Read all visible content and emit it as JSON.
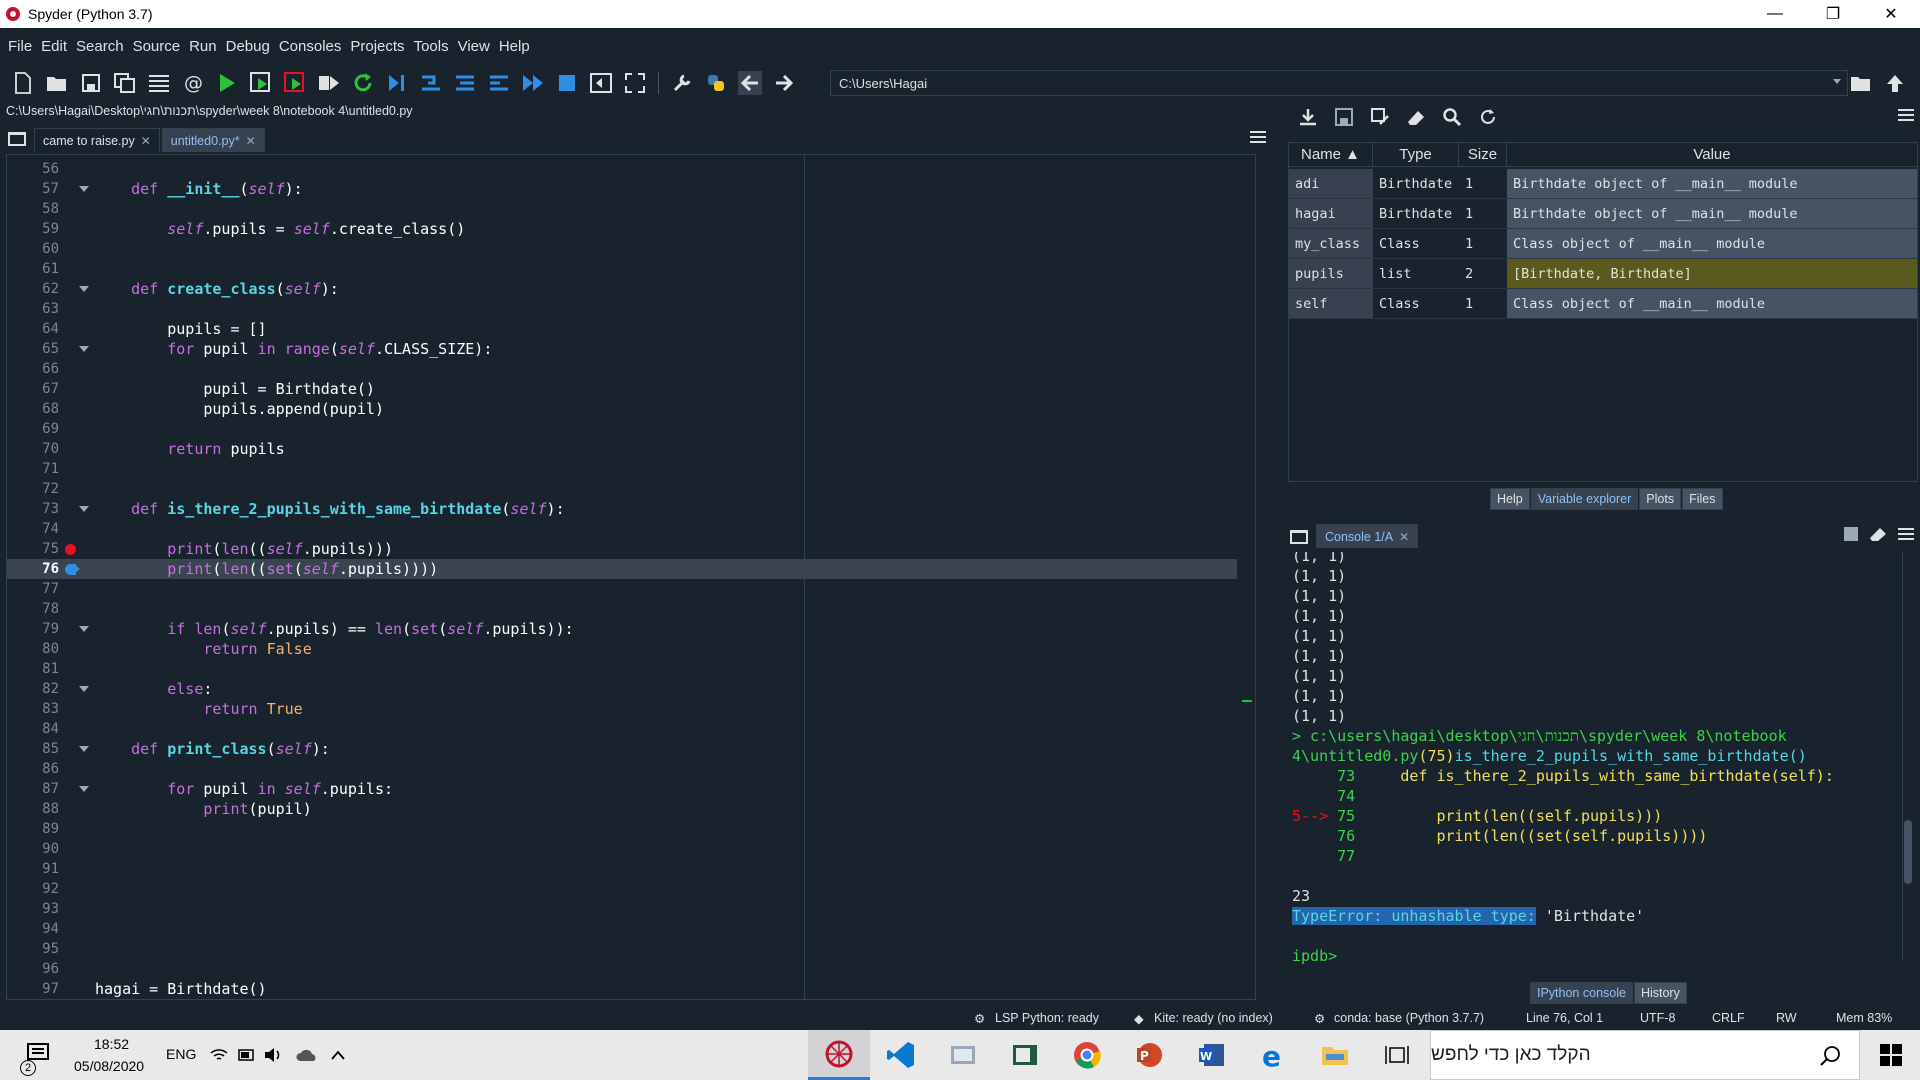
{
  "window": {
    "title": "Spyder (Python 3.7)",
    "minimize": "—",
    "restore": "❐",
    "close": "✕"
  },
  "menu": [
    "File",
    "Edit",
    "Search",
    "Source",
    "Run",
    "Debug",
    "Consoles",
    "Projects",
    "Tools",
    "View",
    "Help"
  ],
  "toolbar": {
    "working_dir": "C:\\Users\\Hagai"
  },
  "editor": {
    "file_path": "C:\\Users\\Hagai\\Desktop\\תכנות\\חגי\\spyder\\week 8\\notebook 4\\untitled0.py",
    "tabs": [
      {
        "label": "came to raise.py",
        "close": "✕"
      },
      {
        "label": "untitled0.py*",
        "close": "✕"
      }
    ],
    "current_line": 76,
    "lines": [
      {
        "n": "56",
        "code": ""
      },
      {
        "n": "57",
        "fold": true,
        "html": "    <span class='kw'>def</span> <span class='fn'>__init__</span>(<span class='sf'>self</span>):"
      },
      {
        "n": "58",
        "code": ""
      },
      {
        "n": "59",
        "html": "        <span class='sf'>self</span>.pupils = <span class='sf'>self</span>.create_class()"
      },
      {
        "n": "60",
        "code": ""
      },
      {
        "n": "61",
        "code": ""
      },
      {
        "n": "62",
        "fold": true,
        "html": "    <span class='kw'>def</span> <span class='fn'>create_class</span>(<span class='sf'>self</span>):"
      },
      {
        "n": "63",
        "code": ""
      },
      {
        "n": "64",
        "html": "        pupils = []"
      },
      {
        "n": "65",
        "fold": true,
        "html": "        <span class='kw'>for</span> pupil <span class='kw'>in</span> <span class='bi'>range</span>(<span class='sf'>self</span>.CLASS_SIZE):"
      },
      {
        "n": "66",
        "code": ""
      },
      {
        "n": "67",
        "html": "            pupil = Birthdate()"
      },
      {
        "n": "68",
        "html": "            pupils.append(pupil)"
      },
      {
        "n": "69",
        "code": ""
      },
      {
        "n": "70",
        "html": "        <span class='kw'>return</span> pupils"
      },
      {
        "n": "71",
        "code": ""
      },
      {
        "n": "72",
        "code": ""
      },
      {
        "n": "73",
        "fold": true,
        "html": "    <span class='kw'>def</span> <span class='fn'>is_there_2_pupils_with_same_birthdate</span>(<span class='sf'>self</span>):"
      },
      {
        "n": "74",
        "code": ""
      },
      {
        "n": "75",
        "bp": "red",
        "html": "        <span class='bi'>print</span>(<span class='bi'>len</span>((<span class='sf'>self</span>.pupils)))"
      },
      {
        "n": "76",
        "bp": "arrow",
        "html": "        <span class='bi'>print</span>(<span class='bi'>len</span>((<span class='bi'>set</span>(<span class='sf'>self</span>.pupils))))"
      },
      {
        "n": "77",
        "code": ""
      },
      {
        "n": "78",
        "code": ""
      },
      {
        "n": "79",
        "fold": true,
        "html": "        <span class='kw'>if</span> <span class='bi'>len</span>(<span class='sf'>self</span>.pupils) == <span class='bi'>len</span>(<span class='bi'>set</span>(<span class='sf'>self</span>.pupils)):"
      },
      {
        "n": "80",
        "html": "            <span class='kw'>return</span> <span class='bt'>False</span>"
      },
      {
        "n": "81",
        "code": ""
      },
      {
        "n": "82",
        "fold": true,
        "html": "        <span class='kw'>else</span>:"
      },
      {
        "n": "83",
        "html": "            <span class='kw'>return</span> <span class='bt'>True</span>"
      },
      {
        "n": "84",
        "code": ""
      },
      {
        "n": "85",
        "fold": true,
        "html": "    <span class='kw'>def</span> <span class='fn'>print_class</span>(<span class='sf'>self</span>):"
      },
      {
        "n": "86",
        "code": ""
      },
      {
        "n": "87",
        "fold": true,
        "html": "        <span class='kw'>for</span> pupil <span class='kw'>in</span> <span class='sf'>self</span>.pupils:"
      },
      {
        "n": "88",
        "html": "            <span class='bi'>print</span>(pupil)"
      },
      {
        "n": "89",
        "code": ""
      },
      {
        "n": "90",
        "code": ""
      },
      {
        "n": "91",
        "code": ""
      },
      {
        "n": "92",
        "code": ""
      },
      {
        "n": "93",
        "code": ""
      },
      {
        "n": "94",
        "code": ""
      },
      {
        "n": "95",
        "code": ""
      },
      {
        "n": "96",
        "code": ""
      },
      {
        "n": "97",
        "html": "hagai = Birthdate()"
      }
    ]
  },
  "variable_explorer": {
    "headers": [
      "Name ▲",
      "Type",
      "Size",
      "Value"
    ],
    "rows": [
      {
        "name": "adi",
        "type": "Birthdate",
        "size": "1",
        "value": "Birthdate object of __main__ module"
      },
      {
        "name": "hagai",
        "type": "Birthdate",
        "size": "1",
        "value": "Birthdate object of __main__ module"
      },
      {
        "name": "my_class",
        "type": "Class",
        "size": "1",
        "value": "Class object of __main__ module"
      },
      {
        "name": "pupils",
        "type": "list",
        "size": "2",
        "value": "[Birthdate, Birthdate]",
        "highlight": true
      },
      {
        "name": "self",
        "type": "Class",
        "size": "1",
        "value": "Class object of __main__ module"
      }
    ],
    "pane_tabs": [
      "Help",
      "Variable explorer",
      "Plots",
      "Files"
    ],
    "active_tab": "Variable explorer"
  },
  "console": {
    "tab_label": "Console 1/A",
    "tab_close": "✕",
    "pane_tabs": [
      "IPython console",
      "History"
    ],
    "active_tab": "IPython console",
    "lines": [
      "(1, 1)",
      "(1, 1)",
      "(1, 1)",
      "(1, 1)",
      "(1, 1)",
      "(1, 1)",
      "(1, 1)",
      "(1, 1)",
      "(1, 1)",
      "> c:\\users\\hagai\\desktop\\תכנות\\חגי\\spyder\\week 8\\notebook",
      "4\\untitled0.py(75)is_there_2_pupils_with_same_birthdate()",
      "     73     def is_there_2_pupils_with_same_birthdate(self):",
      "     74",
      "5--> 75         print(len((self.pupils)))",
      "     76         print(len((set(self.pupils))))",
      "     77",
      "",
      "23",
      "TypeError: unhashable type: 'Birthdate'",
      "",
      "ipdb>"
    ]
  },
  "statusbar": {
    "lsp": "LSP Python: ready",
    "kite": "Kite: ready (no index)",
    "conda": "conda: base (Python 3.7.7)",
    "position": "Line 76, Col 1",
    "encoding": "UTF-8",
    "eol": "CRLF",
    "perm": "RW",
    "mem": "Mem 83%"
  },
  "taskbar": {
    "time": "18:52",
    "date": "05/08/2020",
    "lang": "ENG",
    "notification_count": "2",
    "search_placeholder": "הקלד כאן כדי לחפש",
    "apps": [
      "spyder-icon",
      "vscode-icon",
      "photos-icon",
      "media-icon",
      "chrome-icon",
      "powerpoint-icon",
      "word-icon",
      "edge-icon",
      "explorer-icon",
      "taskview-icon"
    ]
  },
  "colors": {
    "bg": "#19232d",
    "accent": "#8ec1f5",
    "keyword": "#c670e0",
    "function": "#57d6e4",
    "console_green": "#3cd34c"
  }
}
